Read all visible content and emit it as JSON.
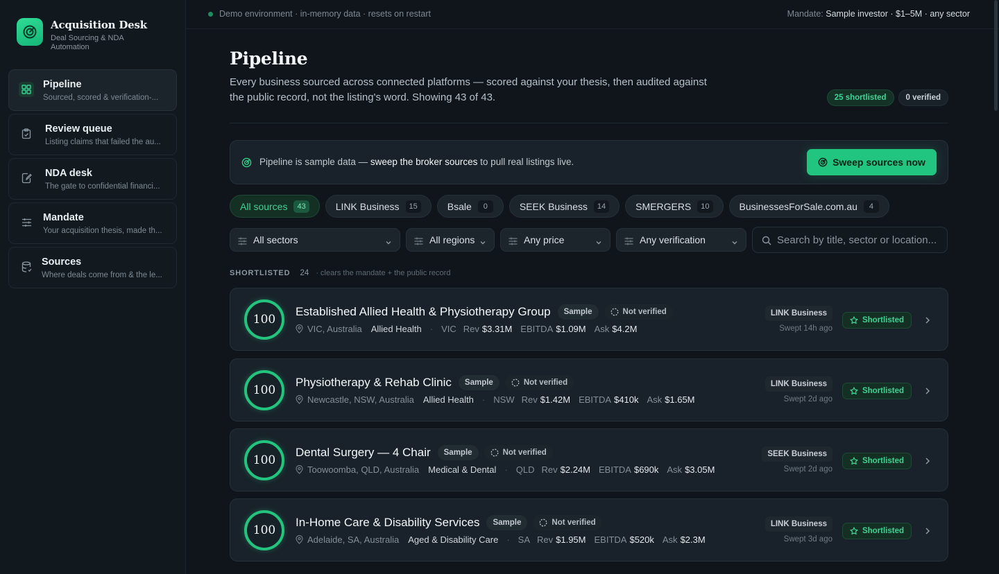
{
  "brand": {
    "title": "Acquisition Desk",
    "subtitle": "Deal Sourcing & NDA Automation"
  },
  "sidebar": {
    "items": [
      {
        "label": "Pipeline",
        "desc": "Sourced, scored & verification-...",
        "icon": "grid-icon",
        "active": true
      },
      {
        "label": "Review queue",
        "desc": "Listing claims that failed the au...",
        "icon": "clipboard-icon"
      },
      {
        "label": "NDA desk",
        "desc": "The gate to confidential financi...",
        "icon": "document-edit-icon"
      },
      {
        "label": "Mandate",
        "desc": "Your acquisition thesis, made th...",
        "icon": "sliders-icon"
      },
      {
        "label": "Sources",
        "desc": "Where deals come from & the le...",
        "icon": "database-icon"
      }
    ]
  },
  "topbar": {
    "env": "Demo environment · in-memory data · resets on restart",
    "mandate_label": "Mandate:",
    "mandate_value": "Sample investor · $1–5M · any sector"
  },
  "page": {
    "title": "Pipeline",
    "description": "Every business sourced across connected platforms — scored against your thesis, then audited against the public record, not the listing's word. Showing 43 of 43.",
    "shortlisted_pill": "25 shortlisted",
    "verified_pill": "0 verified"
  },
  "banner": {
    "text_before": "Pipeline is sample data — ",
    "text_strong": "sweep the broker sources",
    "text_after": " to pull real listings live.",
    "button": "Sweep sources now"
  },
  "tabs": [
    {
      "label": "All sources",
      "count": "43",
      "active": true
    },
    {
      "label": "LINK Business",
      "count": "15"
    },
    {
      "label": "Bsale",
      "count": "0"
    },
    {
      "label": "SEEK Business",
      "count": "14"
    },
    {
      "label": "SMERGERS",
      "count": "10"
    },
    {
      "label": "BusinessesForSale.com.au",
      "count": "4"
    }
  ],
  "filters": {
    "sectors": "All sectors",
    "regions": "All regions",
    "price": "Any price",
    "verification": "Any verification",
    "search_placeholder": "Search by title, sector or location..."
  },
  "section": {
    "title": "SHORTLISTED",
    "count": "24",
    "note": "· clears the mandate + the public record"
  },
  "listings": [
    {
      "score": "100",
      "title": "Established Allied Health & Physiotherapy Group",
      "sample": "Sample",
      "verification": "Not verified",
      "location": "VIC, Australia",
      "sector": "Allied Health",
      "state": "VIC",
      "rev_label": "Rev",
      "rev": "$3.31M",
      "ebitda_label": "EBITDA",
      "ebitda": "$1.09M",
      "ask_label": "Ask",
      "ask": "$4.2M",
      "source": "LINK Business",
      "swept": "Swept 14h ago",
      "status": "Shortlisted"
    },
    {
      "score": "100",
      "title": "Physiotherapy & Rehab Clinic",
      "sample": "Sample",
      "verification": "Not verified",
      "location": "Newcastle, NSW, Australia",
      "sector": "Allied Health",
      "state": "NSW",
      "rev_label": "Rev",
      "rev": "$1.42M",
      "ebitda_label": "EBITDA",
      "ebitda": "$410k",
      "ask_label": "Ask",
      "ask": "$1.65M",
      "source": "LINK Business",
      "swept": "Swept 2d ago",
      "status": "Shortlisted"
    },
    {
      "score": "100",
      "title": "Dental Surgery — 4 Chair",
      "sample": "Sample",
      "verification": "Not verified",
      "location": "Toowoomba, QLD, Australia",
      "sector": "Medical & Dental",
      "state": "QLD",
      "rev_label": "Rev",
      "rev": "$2.24M",
      "ebitda_label": "EBITDA",
      "ebitda": "$690k",
      "ask_label": "Ask",
      "ask": "$3.05M",
      "source": "SEEK Business",
      "swept": "Swept 2d ago",
      "status": "Shortlisted"
    },
    {
      "score": "100",
      "title": "In-Home Care & Disability Services",
      "sample": "Sample",
      "verification": "Not verified",
      "location": "Adelaide, SA, Australia",
      "sector": "Aged & Disability Care",
      "state": "SA",
      "rev_label": "Rev",
      "rev": "$1.95M",
      "ebitda_label": "EBITDA",
      "ebitda": "$520k",
      "ask_label": "Ask",
      "ask": "$2.3M",
      "source": "LINK Business",
      "swept": "Swept 3d ago",
      "status": "Shortlisted"
    }
  ],
  "colors": {
    "accent": "#22c57f",
    "background": "#0f151b",
    "card": "#19222a"
  }
}
